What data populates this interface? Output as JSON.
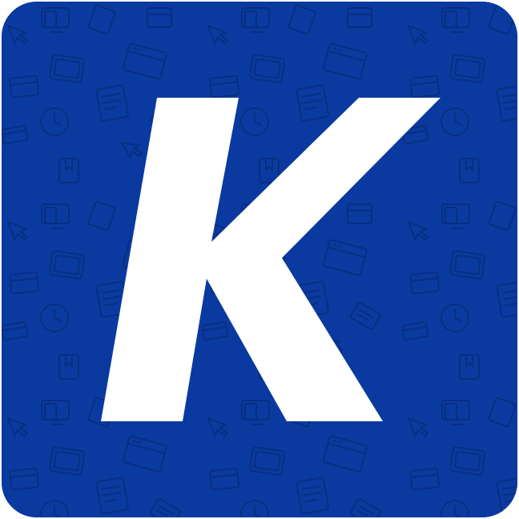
{
  "app_icon": {
    "letter": "K",
    "background_color": "#0a3aa0",
    "pattern_color": "#062c7c",
    "letter_color": "#ffffff",
    "pattern_icons": [
      "monitor-icon",
      "tablet-icon",
      "book-icon",
      "clock-icon",
      "pointer-icon",
      "card-icon",
      "window-icon"
    ]
  }
}
